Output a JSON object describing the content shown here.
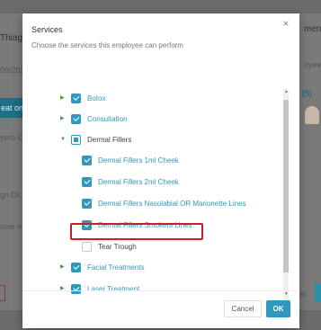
{
  "background": {
    "left_title": "Thiag",
    "left_date": "09/202",
    "left_button": "eat on",
    "left_placeholder": "yers Cl",
    "left_placeholder2": "gn Dr.",
    "left_new": "new n",
    "right_title": "ment",
    "right_placeholder": "oyee Na",
    "right_count": "(5)",
    "right_cancel": "el"
  },
  "modal": {
    "title": "Services",
    "subtitle": "Choose the services this employee can perform",
    "close_glyph": "×"
  },
  "services": [
    {
      "label": "Botox",
      "state": "checked",
      "expand": "collapsed",
      "link": true
    },
    {
      "label": "Consultation",
      "state": "checked",
      "expand": "collapsed",
      "link": true
    },
    {
      "label": "Dermal Fillers",
      "state": "partial",
      "expand": "expanded",
      "link": false
    },
    {
      "label": "Dermal Fillers 1ml Cheek",
      "state": "checked",
      "expand": "none",
      "link": true
    },
    {
      "label": "Dermal Fillers 2ml Cheek",
      "state": "checked",
      "expand": "none",
      "link": true
    },
    {
      "label": "Dermal Fillers Nasolabial OR Marionette Lines",
      "state": "checked",
      "expand": "none",
      "link": true
    },
    {
      "label": "Dermal Fillers Smokers Lines",
      "state": "checked",
      "expand": "none",
      "link": true
    },
    {
      "label": "Tear Trough",
      "state": "unchecked",
      "expand": "none",
      "link": false
    },
    {
      "label": "Facial Treatments",
      "state": "checked",
      "expand": "collapsed",
      "link": true
    },
    {
      "label": "Laser Treatment",
      "state": "checked",
      "expand": "collapsed",
      "link": true
    }
  ],
  "footer": {
    "cancel_label": "Cancel",
    "ok_label": "OK"
  },
  "colors": {
    "accent": "#2f99bd",
    "highlight": "#c81e2a"
  }
}
